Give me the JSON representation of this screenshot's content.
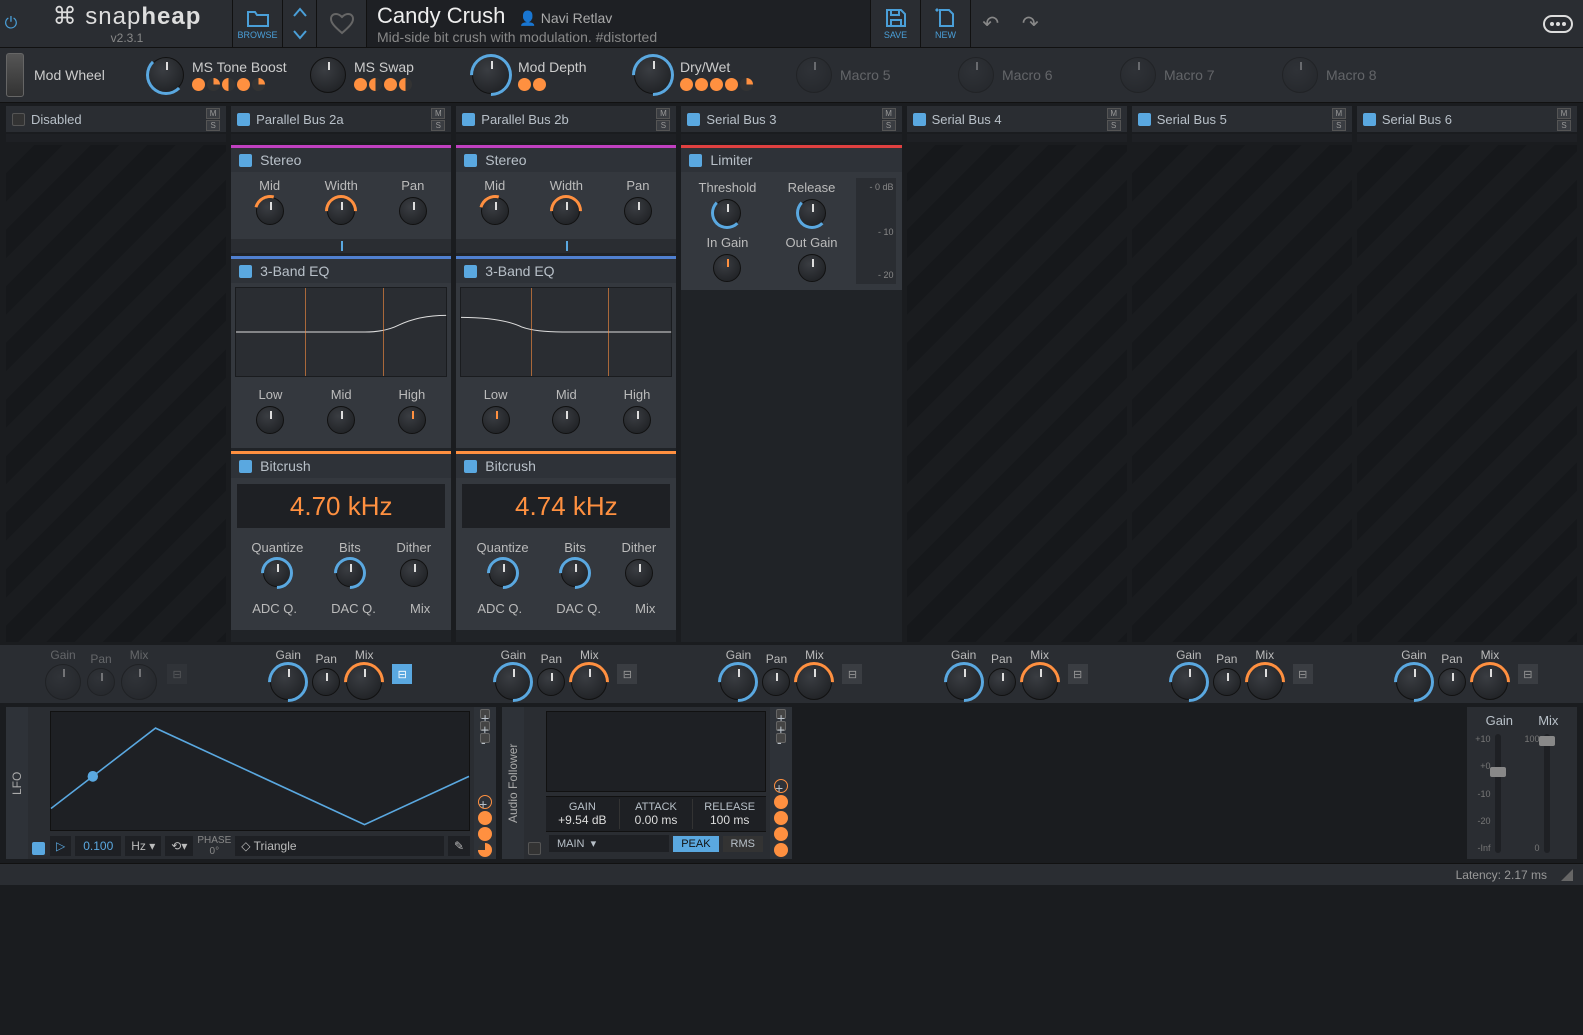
{
  "app": {
    "name_a": "snap",
    "name_b": "heap",
    "version": "v2.3.1"
  },
  "topbar": {
    "browse": "BROWSE",
    "save": "SAVE",
    "new": "NEW"
  },
  "preset": {
    "name": "Candy Crush",
    "author": "Navi Retlav",
    "desc": "Mid-side bit crush with modulation. #distorted"
  },
  "macros": {
    "modwheel": "Mod Wheel",
    "items": [
      {
        "label": "MS Tone Boost",
        "dim": false
      },
      {
        "label": "MS Swap",
        "dim": false
      },
      {
        "label": "Mod Depth",
        "dim": false
      },
      {
        "label": "Dry/Wet",
        "dim": false
      },
      {
        "label": "Macro 5",
        "dim": true
      },
      {
        "label": "Macro 6",
        "dim": true
      },
      {
        "label": "Macro 7",
        "dim": true
      },
      {
        "label": "Macro 8",
        "dim": true
      }
    ]
  },
  "lanes": [
    {
      "name": "Disabled",
      "enabled": false,
      "m": "M",
      "s": "S"
    },
    {
      "name": "Parallel Bus 2a",
      "enabled": true,
      "m": "M",
      "s": "S"
    },
    {
      "name": "Parallel Bus 2b",
      "enabled": true,
      "m": "M",
      "s": "S"
    },
    {
      "name": "Serial Bus 3",
      "enabled": true,
      "m": "M",
      "s": "S"
    },
    {
      "name": "Serial Bus 4",
      "enabled": true,
      "m": "M",
      "s": "S"
    },
    {
      "name": "Serial Bus 5",
      "enabled": true,
      "m": "M",
      "s": "S"
    },
    {
      "name": "Serial Bus 6",
      "enabled": true,
      "m": "M",
      "s": "S"
    }
  ],
  "stereo": {
    "title": "Stereo",
    "k": [
      "Mid",
      "Width",
      "Pan"
    ]
  },
  "eq": {
    "title": "3-Band EQ",
    "k": [
      "Low",
      "Mid",
      "High"
    ]
  },
  "bitcrush": {
    "title": "Bitcrush",
    "val_a": "4.70 kHz",
    "val_b": "4.74 kHz",
    "k1": [
      "Quantize",
      "Bits",
      "Dither"
    ],
    "k2": [
      "ADC Q.",
      "DAC Q.",
      "Mix"
    ]
  },
  "limiter": {
    "title": "Limiter",
    "k": [
      "Threshold",
      "Release",
      "In Gain",
      "Out Gain"
    ],
    "ticks": [
      "- 0 dB",
      "- 10",
      "- 20"
    ]
  },
  "gainrow": {
    "labels": [
      "Gain",
      "Pan",
      "Mix"
    ]
  },
  "lfo": {
    "title": "LFO",
    "rate": "0.100",
    "unit": "Hz",
    "phase_lbl": "PHASE",
    "phase": "0°",
    "shape": "Triangle"
  },
  "af": {
    "title": "Audio Follower",
    "gain_l": "GAIN",
    "gain_v": "+9.54 dB",
    "atk_l": "ATTACK",
    "atk_v": "0.00 ms",
    "rel_l": "RELEASE",
    "rel_v": "100 ms",
    "src": "MAIN",
    "peak": "PEAK",
    "rms": "RMS"
  },
  "master": {
    "gain": "Gain",
    "mix": "Mix",
    "ticks": [
      "+10",
      "+0",
      "-10",
      "-20",
      "-Inf"
    ],
    "mixticks": [
      "100",
      "0"
    ]
  },
  "status": {
    "latency": "Latency: 2.17 ms"
  }
}
